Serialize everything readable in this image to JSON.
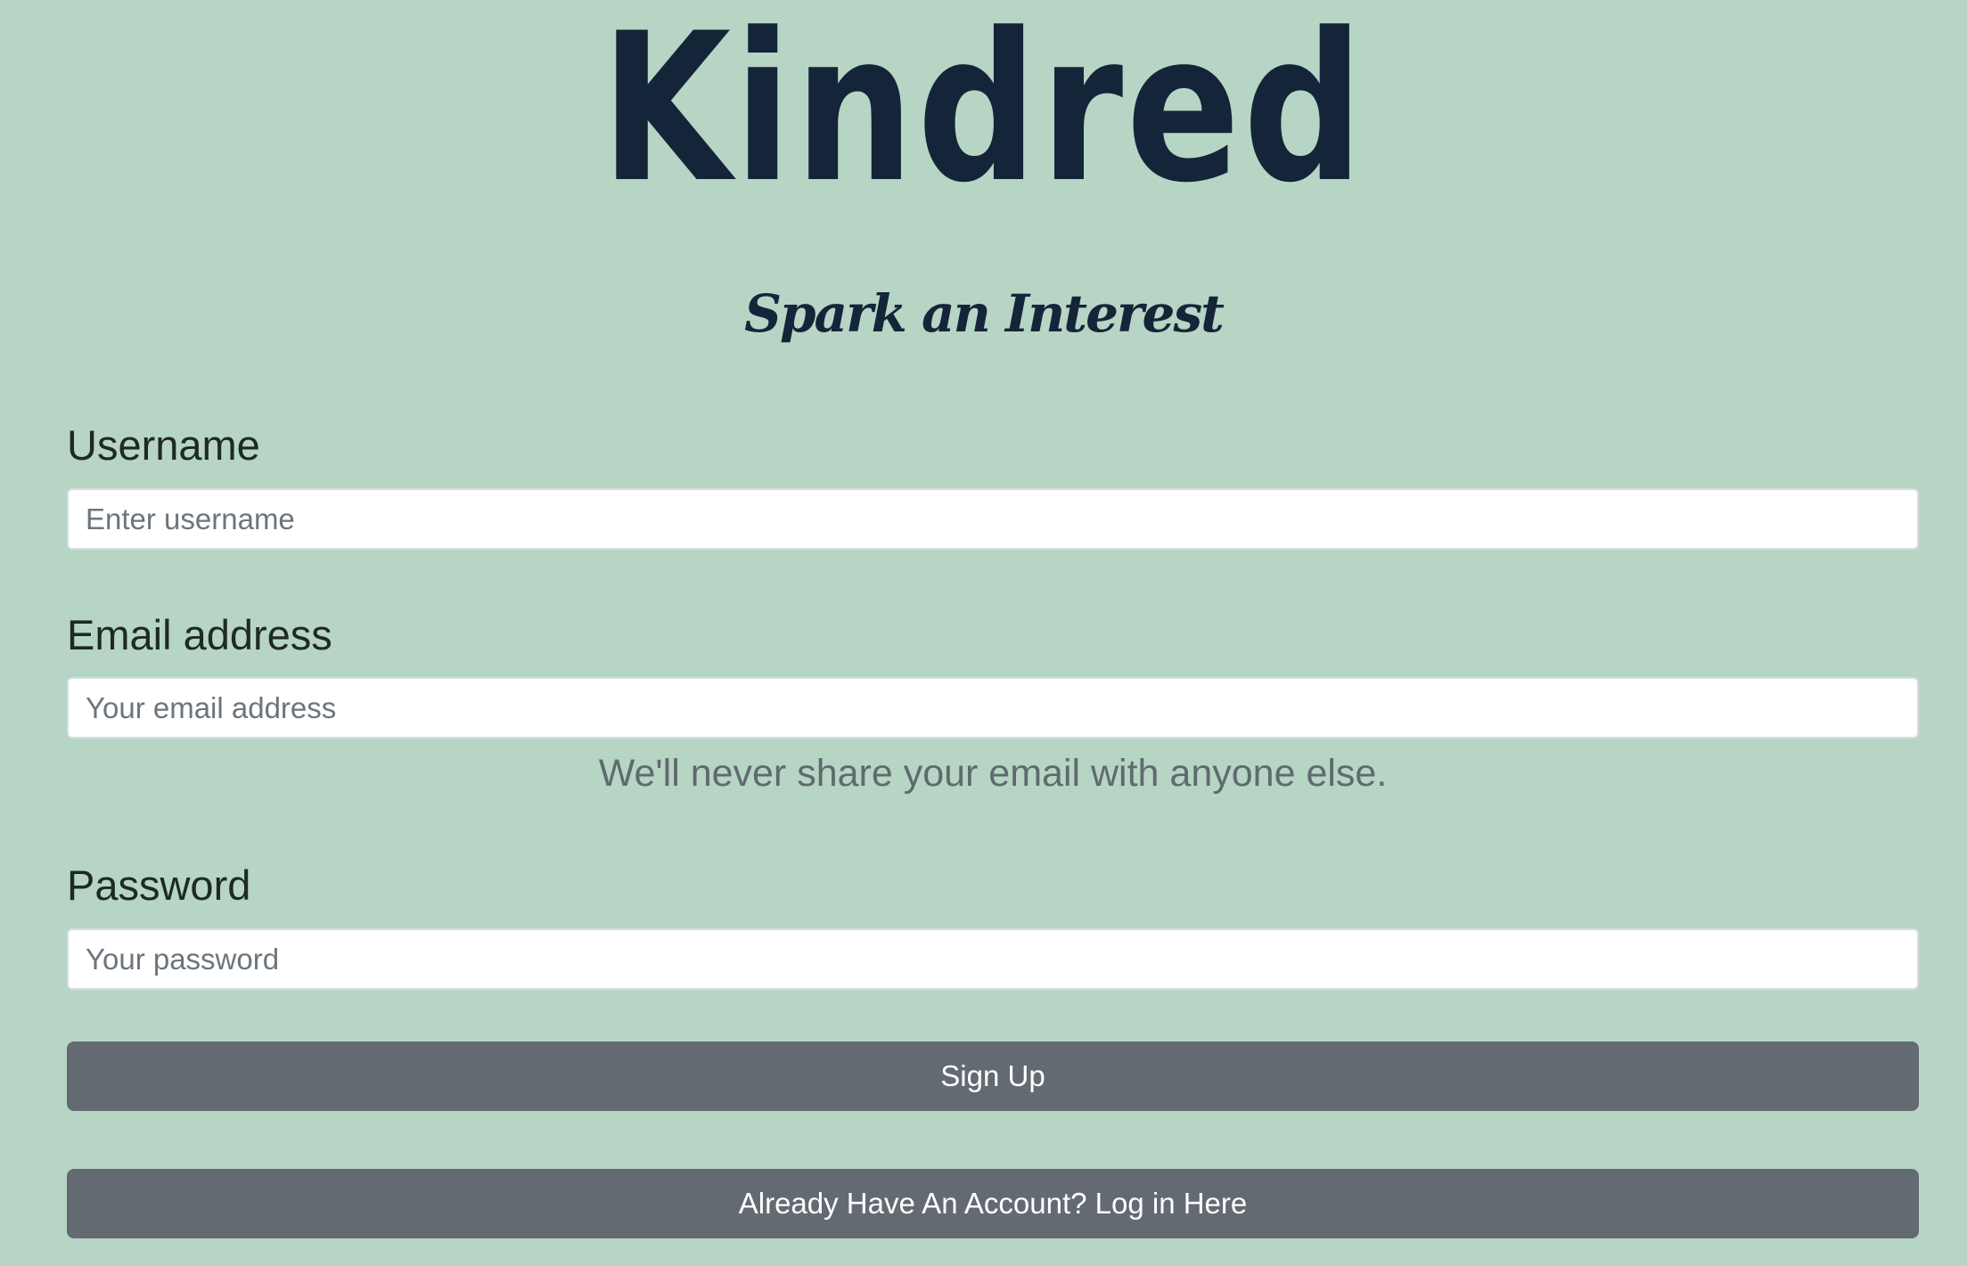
{
  "brand": {
    "logo_text": "Kindred",
    "tagline": "Spark an Interest"
  },
  "form": {
    "username": {
      "label": "Username",
      "placeholder": "Enter username",
      "value": ""
    },
    "email": {
      "label": "Email address",
      "placeholder": "Your email address",
      "value": "",
      "help": "We'll never share your email with anyone else."
    },
    "password": {
      "label": "Password",
      "placeholder": "Your password",
      "value": ""
    },
    "signup_button": "Sign Up",
    "login_button": "Already Have An Account? Log in Here"
  },
  "colors": {
    "background": "#b7d5c4",
    "brand_text": "#14253a",
    "button": "#636a72",
    "button_text": "#ffffff"
  }
}
